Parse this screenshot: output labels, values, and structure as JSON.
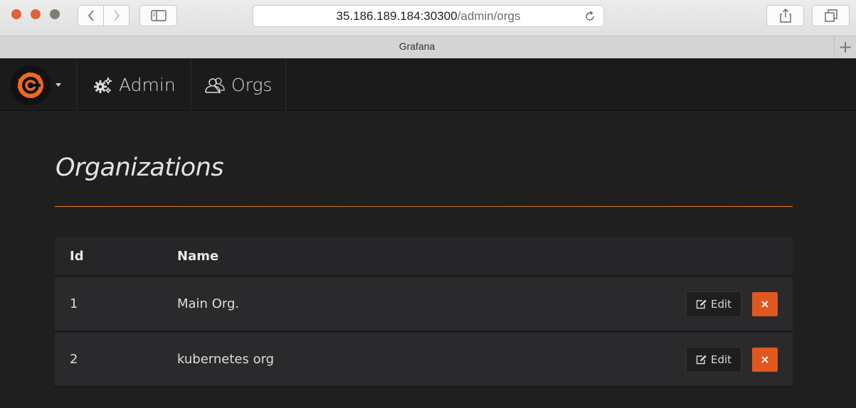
{
  "browser": {
    "url_host": "35.186.189.184:30300",
    "url_path": "/admin/orgs",
    "tab_title": "Grafana"
  },
  "topnav": {
    "admin_label": "Admin",
    "orgs_label": "Orgs"
  },
  "page": {
    "title": "Organizations"
  },
  "table": {
    "columns": [
      "Id",
      "Name"
    ],
    "rows": [
      {
        "id": "1",
        "name": "Main Org.",
        "edit_label": "Edit",
        "delete_label": "×"
      },
      {
        "id": "2",
        "name": "kubernetes org",
        "edit_label": "Edit",
        "delete_label": "×"
      }
    ]
  },
  "colors": {
    "accent": "#eb7b18",
    "danger": "#e0581f",
    "background": "#1f1f20"
  }
}
